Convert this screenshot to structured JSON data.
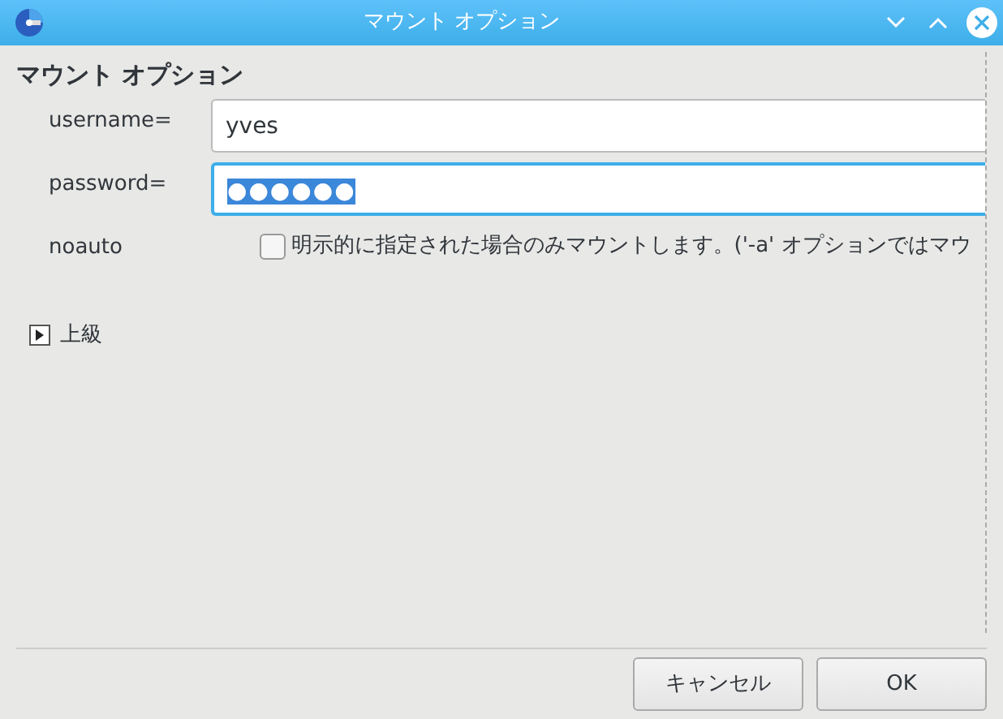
{
  "window": {
    "title": "マウント オプション"
  },
  "heading": "マウント オプション",
  "fields": [
    {
      "label": "username=",
      "kind": "text",
      "value": "yves",
      "focused": false
    },
    {
      "label": "password=",
      "kind": "password",
      "value": "●●●●●●",
      "focused": true
    },
    {
      "label": "noauto",
      "kind": "checkbox",
      "text": "明示的に指定された場合のみマウントします。('-a' オプションではマウ",
      "checked": false
    }
  ],
  "advanced": {
    "label": "上級",
    "expanded": false
  },
  "buttons": [
    "キャンセル",
    "OK"
  ]
}
